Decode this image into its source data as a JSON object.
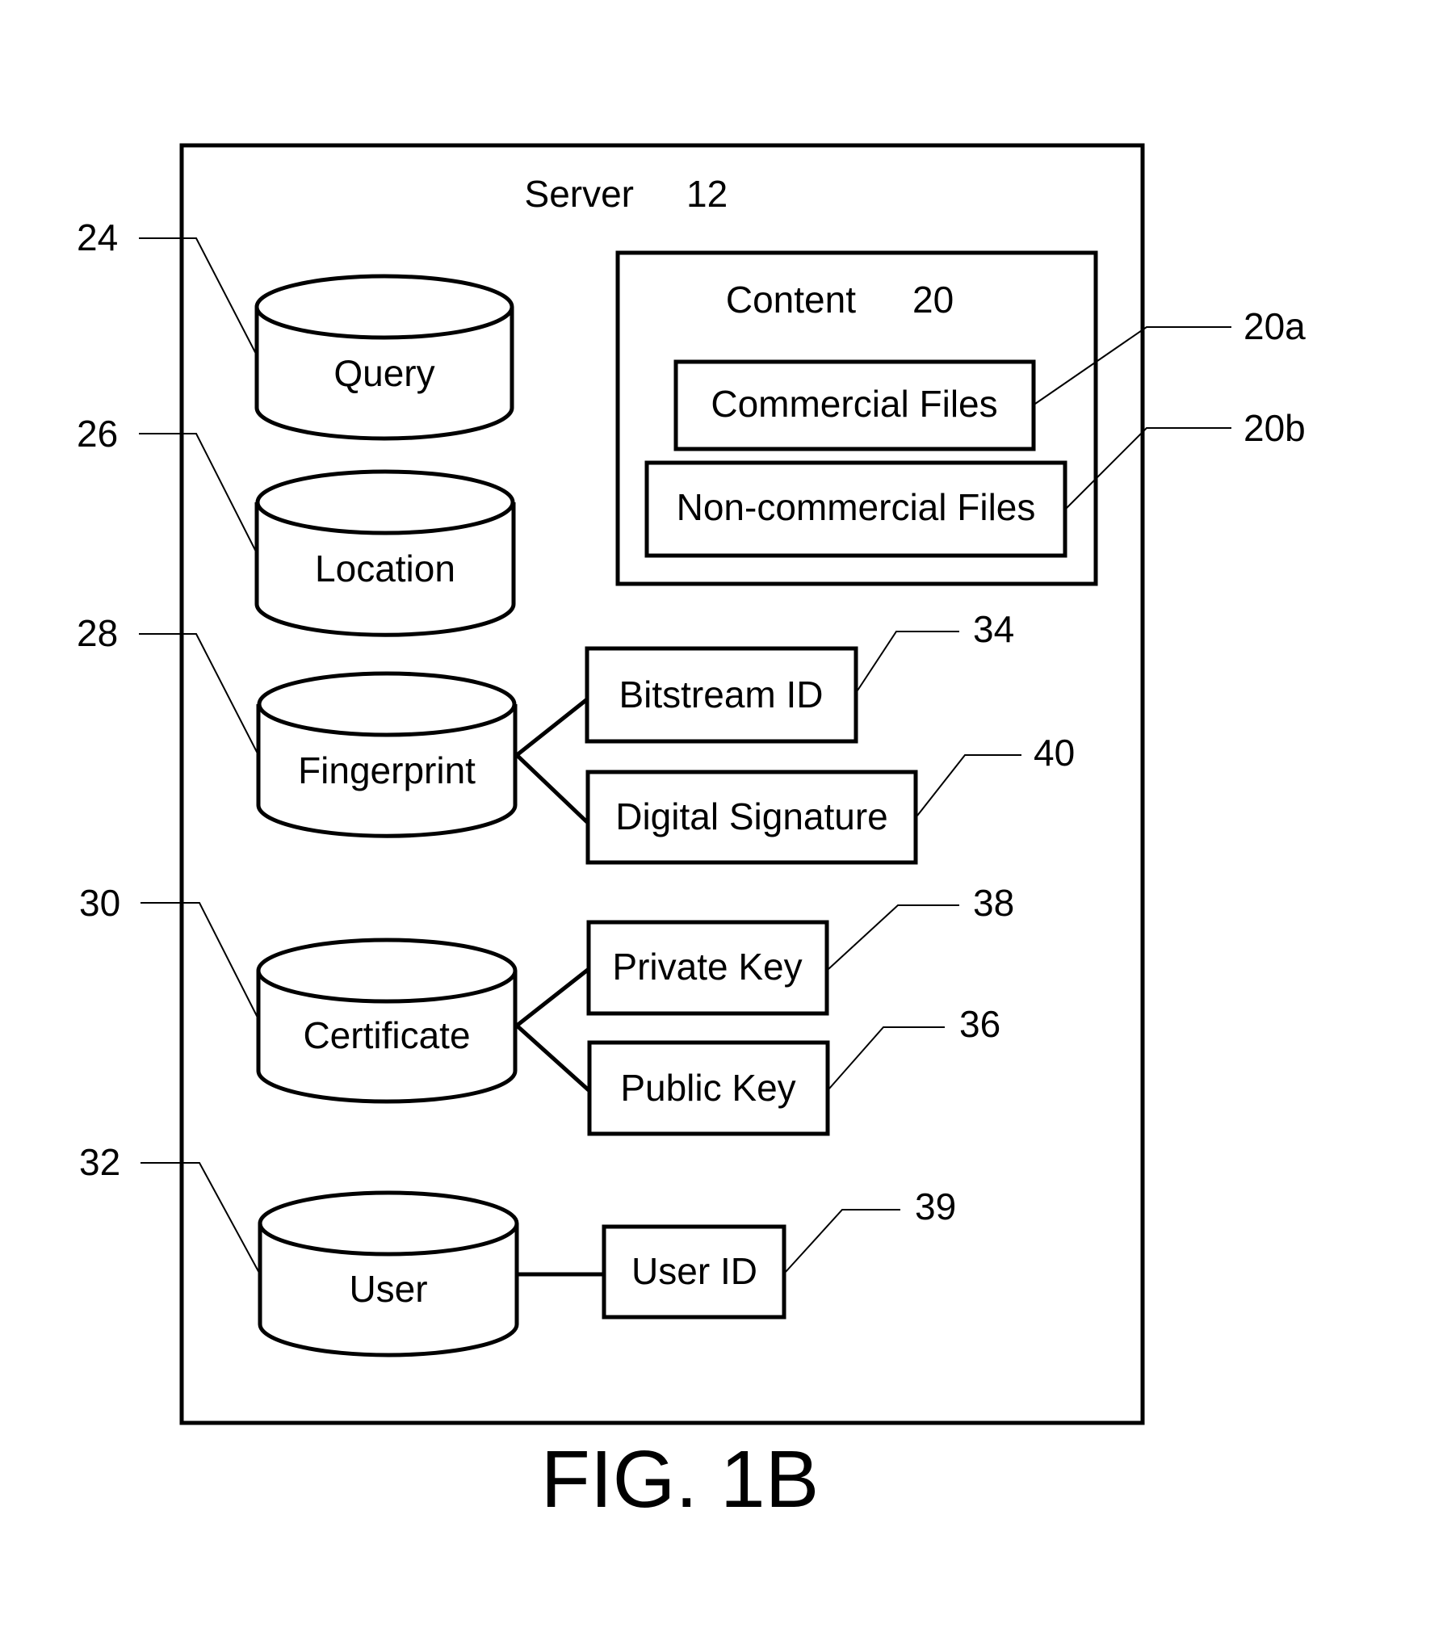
{
  "server": {
    "label": "Server",
    "ref": "12"
  },
  "content": {
    "label": "Content",
    "ref": "20"
  },
  "content_items": [
    {
      "label": "Commercial Files",
      "ref": "20a"
    },
    {
      "label": "Non-commercial Files",
      "ref": "20b"
    }
  ],
  "databases": [
    {
      "label": "Query",
      "ref": "24"
    },
    {
      "label": "Location",
      "ref": "26"
    },
    {
      "label": "Fingerprint",
      "ref": "28"
    },
    {
      "label": "Certificate",
      "ref": "30"
    },
    {
      "label": "User",
      "ref": "32"
    }
  ],
  "fingerprint_items": [
    {
      "label": "Bitstream ID",
      "ref": "34"
    },
    {
      "label": "Digital Signature",
      "ref": "40"
    }
  ],
  "certificate_items": [
    {
      "label": "Private Key",
      "ref": "38"
    },
    {
      "label": "Public Key",
      "ref": "36"
    }
  ],
  "user_items": [
    {
      "label": "User ID",
      "ref": "39"
    }
  ],
  "figure_label": "FIG. 1B"
}
